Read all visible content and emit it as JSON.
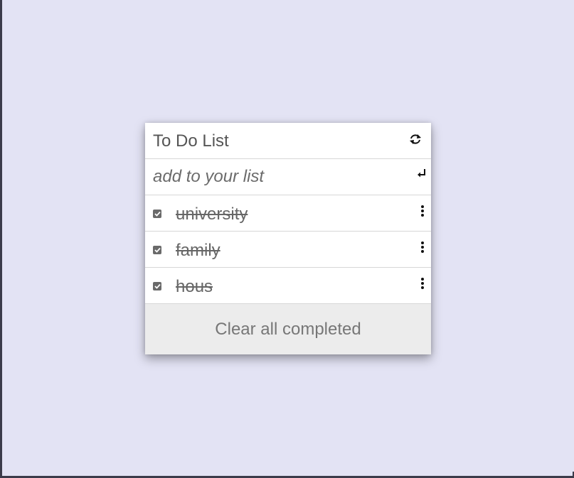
{
  "todo": {
    "title": "To Do List",
    "refresh_icon": "refresh-icon",
    "input": {
      "placeholder": "add to your list",
      "value": "",
      "submit_icon": "enter-icon"
    },
    "items": [
      {
        "label": "university",
        "completed": true
      },
      {
        "label": "family",
        "completed": true
      },
      {
        "label": "hous",
        "completed": true
      }
    ],
    "clear_button": "Clear all completed"
  },
  "colors": {
    "page_background": "#e3e3f4",
    "ruled_lines": "#4a57c9",
    "card_background": "#ffffff",
    "footer_background": "#ececec",
    "text": "#555555"
  }
}
